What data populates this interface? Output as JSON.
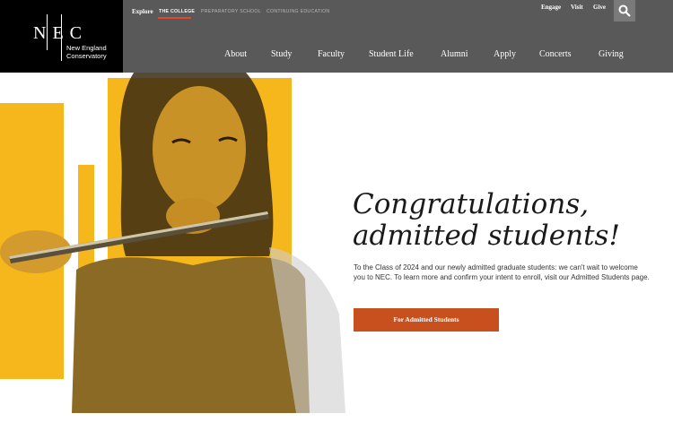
{
  "logo": {
    "mark": "N E C",
    "line1": "New England",
    "line2": "Conservatory"
  },
  "top_bar": {
    "explore_label": "Explore",
    "schools": [
      "THE COLLEGE",
      "PREPARATORY SCHOOL",
      "CONTINUING EDUCATION"
    ],
    "utility_links": [
      "Engage",
      "Visit",
      "Give"
    ],
    "search_icon": "search-icon"
  },
  "main_nav": [
    "About",
    "Study",
    "Faculty",
    "Student Life",
    "Alumni",
    "Apply",
    "Concerts",
    "Giving"
  ],
  "hero": {
    "headline_line1": "Congratulations,",
    "headline_line2": "admitted students!",
    "intro": "To the Class of 2024 and our newly admitted graduate students: we can't wait to welcome you to NEC. To learn more and confirm your intent to enroll, visit our Admitted Students page.",
    "cta_label": "For Admitted Students"
  },
  "colors": {
    "header_bg": "#595959",
    "accent_yellow": "#f5b71b",
    "cta": "#c8501f",
    "underline": "#e2452a"
  }
}
